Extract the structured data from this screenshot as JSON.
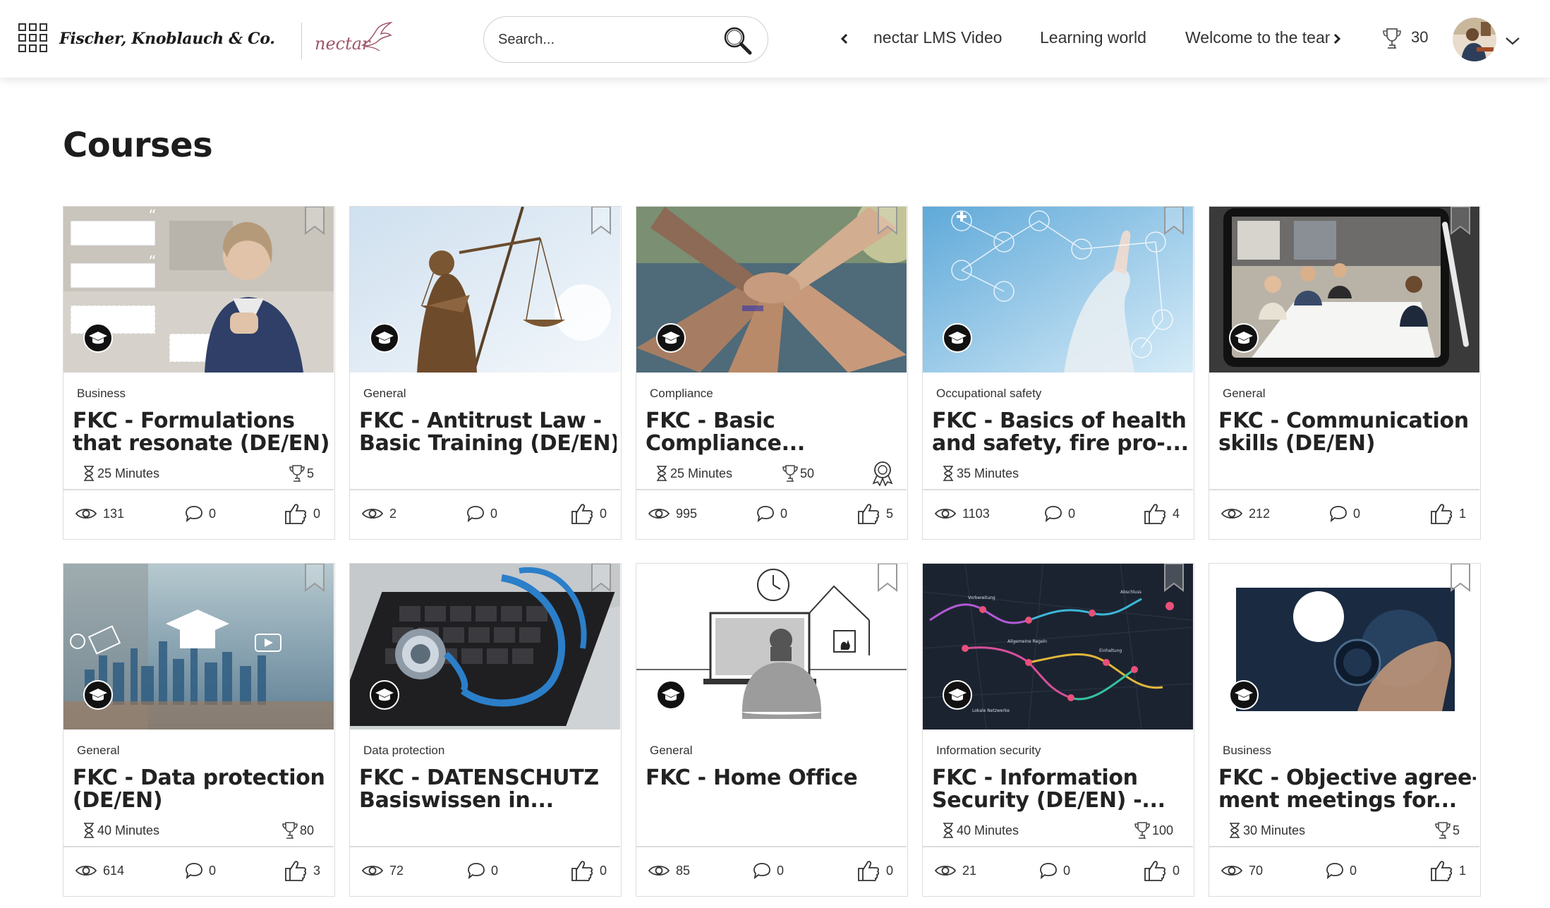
{
  "header": {
    "brand": "Fischer, Knoblauch & Co.",
    "app_logo": "nectar",
    "search_placeholder": "Search...",
    "nav_items": [
      "nectar LMS Video",
      "Learning world",
      "Welcome to the team"
    ],
    "points": "30",
    "icons": {
      "menu": "app-grid-icon",
      "search": "search-icon",
      "prev": "chevron-left-icon",
      "next": "chevron-right-icon",
      "points": "trophy-icon",
      "account": "chevron-down-icon"
    }
  },
  "page": {
    "title": "Courses"
  },
  "courses": [
    {
      "category": "Business",
      "title_lines": [
        "FKC - Formulations",
        "that resonate (DE/EN)"
      ],
      "duration": "25 Minutes",
      "points": "5",
      "certificate": false,
      "views": "131",
      "comments": "0",
      "likes": "0"
    },
    {
      "category": "General",
      "title_lines": [
        "FKC - Antitrust Law -",
        "Basic Training (DE/EN)"
      ],
      "duration": "",
      "points": "",
      "certificate": false,
      "views": "2",
      "comments": "0",
      "likes": "0"
    },
    {
      "category": "Compliance",
      "title_lines": [
        "FKC - Basic",
        "Compliance..."
      ],
      "duration": "25 Minutes",
      "points": "50",
      "certificate": true,
      "views": "995",
      "comments": "0",
      "likes": "5"
    },
    {
      "category": "Occupational safety",
      "title_lines": [
        "FKC - Basics of health",
        "and safety, fire pro-..."
      ],
      "duration": "35 Minutes",
      "points": "",
      "certificate": false,
      "views": "1103",
      "comments": "0",
      "likes": "4"
    },
    {
      "category": "General",
      "title_lines": [
        "FKC - Communication",
        "skills (DE/EN)"
      ],
      "duration": "",
      "points": "",
      "certificate": false,
      "views": "212",
      "comments": "0",
      "likes": "1"
    },
    {
      "category": "General",
      "title_lines": [
        "FKC - Data protection",
        "(DE/EN)"
      ],
      "duration": "40 Minutes",
      "points": "80",
      "certificate": false,
      "views": "614",
      "comments": "0",
      "likes": "3"
    },
    {
      "category": "Data protection",
      "title_lines": [
        "FKC - DATENSCHUTZ",
        "Basiswissen in..."
      ],
      "duration": "",
      "points": "",
      "certificate": false,
      "views": "72",
      "comments": "0",
      "likes": "0"
    },
    {
      "category": "General",
      "title_lines": [
        "FKC - Home Office",
        ""
      ],
      "duration": "",
      "points": "",
      "certificate": false,
      "views": "85",
      "comments": "0",
      "likes": "0"
    },
    {
      "category": "Information security",
      "title_lines": [
        "FKC - Information",
        "Security (DE/EN) -..."
      ],
      "duration": "40 Minutes",
      "points": "100",
      "certificate": false,
      "views": "21",
      "comments": "0",
      "likes": "0"
    },
    {
      "category": "Business",
      "title_lines": [
        "FKC - Objective agree-",
        "ment meetings for..."
      ],
      "duration": "30 Minutes",
      "points": "5",
      "certificate": false,
      "views": "70",
      "comments": "0",
      "likes": "1"
    }
  ],
  "card_icons": {
    "bookmark": "bookmark-icon",
    "course_type": "graduation-cap-icon",
    "duration": "hourglass-icon",
    "points": "trophy-icon",
    "certificate": "certificate-badge-icon",
    "views": "eye-icon",
    "comments": "comment-icon",
    "likes": "thumbs-up-icon"
  },
  "colors": {
    "brand_accent": "#a0566a",
    "text": "#222222",
    "card_border": "#dcdcdc"
  }
}
